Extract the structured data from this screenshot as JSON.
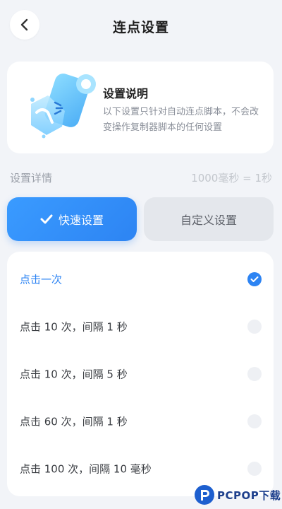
{
  "header": {
    "title": "连点设置"
  },
  "info": {
    "title": "设置说明",
    "description": "以下设置只针对自动连点脚本，不会改变操作复制器脚本的任何设置"
  },
  "details": {
    "label": "设置详情",
    "note": "1000毫秒 = 1秒"
  },
  "tabs": {
    "quick": "快速设置",
    "custom": "自定义设置",
    "active": "quick"
  },
  "options": [
    {
      "label": "点击一次",
      "selected": true
    },
    {
      "label": "点击 10 次，间隔 1 秒",
      "selected": false
    },
    {
      "label": "点击 10 次，间隔 5 秒",
      "selected": false
    },
    {
      "label": "点击 60 次，间隔 1 秒",
      "selected": false
    },
    {
      "label": "点击 100 次，间隔 10  毫秒",
      "selected": false
    }
  ],
  "watermark": {
    "text": "PCPOP下载"
  },
  "colors": {
    "accent": "#2d84f3",
    "background": "#f2f4f8",
    "card": "#ffffff",
    "inactive_tab": "#e4e7ec"
  }
}
